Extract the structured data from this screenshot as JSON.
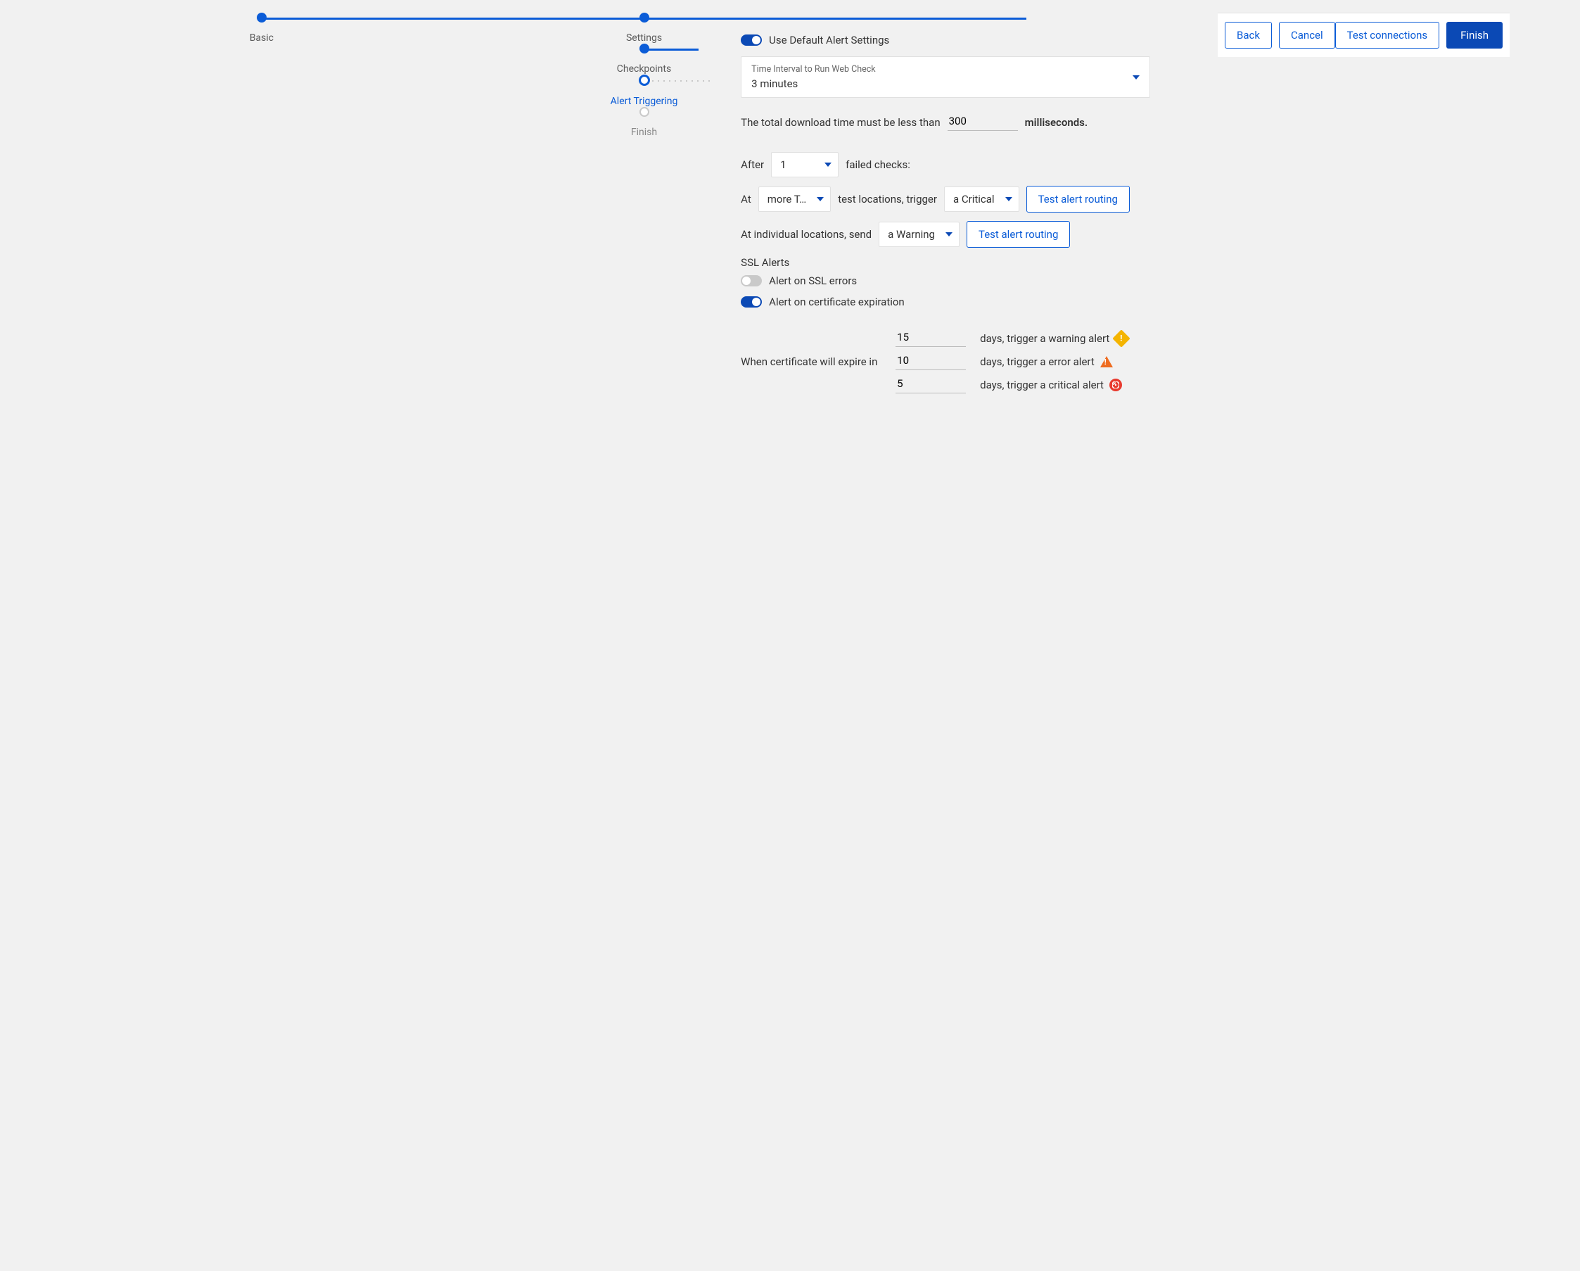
{
  "stepper": {
    "steps": [
      {
        "label": "Basic",
        "state": "done"
      },
      {
        "label": "Settings",
        "state": "done"
      },
      {
        "label": "Checkpoints",
        "state": "done"
      },
      {
        "label": "Alert Triggering",
        "state": "active"
      },
      {
        "label": "Finish",
        "state": "todo"
      }
    ]
  },
  "form": {
    "use_default_label": "Use Default Alert Settings",
    "use_default_on": true,
    "interval_label": "Time Interval to Run Web Check",
    "interval_value": "3 minutes",
    "download_pre": "The total download time must be less than",
    "download_ms": "300",
    "download_post": "milliseconds.",
    "after_label": "After",
    "failed_count": "1",
    "failed_post": "failed checks:",
    "at_label": "At",
    "locations_value": "more T…",
    "locations_post": "test locations, trigger",
    "severity_loc": "a Critical",
    "test_routing_btn": "Test alert routing",
    "indiv_pre": "At individual locations, send",
    "severity_indiv": "a Warning",
    "ssl_header": "SSL Alerts",
    "ssl_error_label": "Alert on SSL errors",
    "ssl_error_on": false,
    "cert_exp_label": "Alert on certificate expiration",
    "cert_exp_on": true,
    "cert_lead": "When certificate will expire in",
    "cert": {
      "warning": {
        "days": "15",
        "text": "days, trigger a warning alert"
      },
      "error": {
        "days": "10",
        "text": "days, trigger a error alert"
      },
      "critical": {
        "days": "5",
        "text": "days, trigger a critical alert"
      }
    }
  },
  "footer": {
    "back": "Back",
    "cancel": "Cancel",
    "test_conn": "Test connections",
    "finish": "Finish"
  }
}
